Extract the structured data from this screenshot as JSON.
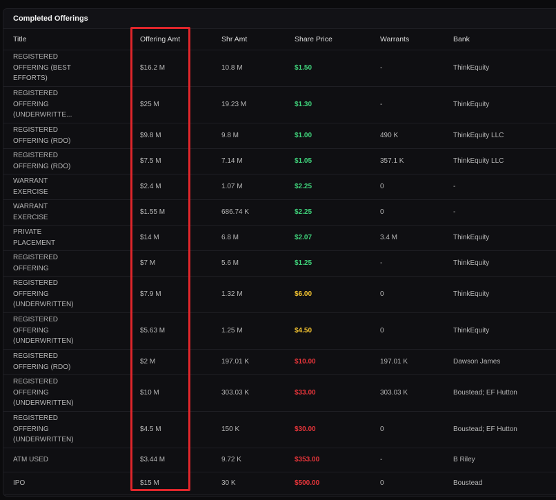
{
  "panel": {
    "title": "Completed Offerings"
  },
  "columns": [
    "Title",
    "Offering Amt",
    "Shr Amt",
    "Share Price",
    "Warrants",
    "Bank"
  ],
  "colors": {
    "green": "#3fd17a",
    "yellow": "#f2c230",
    "red": "#e8353a",
    "highlight": "#e0262b"
  },
  "rows": [
    {
      "title": "REGISTERED OFFERING (BEST EFFORTS)",
      "offering_amt": "$16.2 M",
      "shr_amt": "10.8 M",
      "share_price": "$1.50",
      "price_color": "green",
      "warrants": "-",
      "bank": "ThinkEquity",
      "h": 53
    },
    {
      "title": "REGISTERED OFFERING (UNDERWRITTE...",
      "offering_amt": "$25 M",
      "shr_amt": "19.23 M",
      "share_price": "$1.30",
      "price_color": "green",
      "warrants": "-",
      "bank": "ThinkEquity",
      "h": 53
    },
    {
      "title": "REGISTERED OFFERING (RDO)",
      "offering_amt": "$9.8 M",
      "shr_amt": "9.8 M",
      "share_price": "$1.00",
      "price_color": "green",
      "warrants": "490 K",
      "bank": "ThinkEquity LLC",
      "h": 37
    },
    {
      "title": "REGISTERED OFFERING (RDO)",
      "offering_amt": "$7.5 M",
      "shr_amt": "7.14 M",
      "share_price": "$1.05",
      "price_color": "green",
      "warrants": "357.1 K",
      "bank": "ThinkEquity LLC",
      "h": 37
    },
    {
      "title": "WARRANT EXERCISE",
      "offering_amt": "$2.4 M",
      "shr_amt": "1.07 M",
      "share_price": "$2.25",
      "price_color": "green",
      "warrants": "0",
      "bank": "-",
      "h": 37
    },
    {
      "title": "WARRANT EXERCISE",
      "offering_amt": "$1.55 M",
      "shr_amt": "686.74 K",
      "share_price": "$2.25",
      "price_color": "green",
      "warrants": "0",
      "bank": "-",
      "h": 37
    },
    {
      "title": "PRIVATE PLACEMENT",
      "offering_amt": "$14 M",
      "shr_amt": "6.8 M",
      "share_price": "$2.07",
      "price_color": "green",
      "warrants": "3.4 M",
      "bank": "ThinkEquity",
      "h": 37
    },
    {
      "title": "REGISTERED OFFERING",
      "offering_amt": "$7 M",
      "shr_amt": "5.6 M",
      "share_price": "$1.25",
      "price_color": "green",
      "warrants": "-",
      "bank": "ThinkEquity",
      "h": 37
    },
    {
      "title": "REGISTERED OFFERING (UNDERWRITTEN)",
      "offering_amt": "$7.9 M",
      "shr_amt": "1.32 M",
      "share_price": "$6.00",
      "price_color": "yellow",
      "warrants": "0",
      "bank": "ThinkEquity",
      "h": 53
    },
    {
      "title": "REGISTERED OFFERING (UNDERWRITTEN)",
      "offering_amt": "$5.63 M",
      "shr_amt": "1.25 M",
      "share_price": "$4.50",
      "price_color": "yellow",
      "warrants": "0",
      "bank": "ThinkEquity",
      "h": 53
    },
    {
      "title": "REGISTERED OFFERING (RDO)",
      "offering_amt": "$2 M",
      "shr_amt": "197.01 K",
      "share_price": "$10.00",
      "price_color": "red",
      "warrants": "197.01 K",
      "bank": "Dawson James",
      "h": 37
    },
    {
      "title": "REGISTERED OFFERING (UNDERWRITTEN)",
      "offering_amt": "$10 M",
      "shr_amt": "303.03 K",
      "share_price": "$33.00",
      "price_color": "red",
      "warrants": "303.03 K",
      "bank": "Boustead; EF Hutton",
      "h": 53
    },
    {
      "title": "REGISTERED OFFERING (UNDERWRITTEN)",
      "offering_amt": "$4.5 M",
      "shr_amt": "150 K",
      "share_price": "$30.00",
      "price_color": "red",
      "warrants": "0",
      "bank": "Boustead; EF Hutton",
      "h": 53
    },
    {
      "title": "ATM USED",
      "offering_amt": "$3.44 M",
      "shr_amt": "9.72 K",
      "share_price": "$353.00",
      "price_color": "red",
      "warrants": "-",
      "bank": "B Riley",
      "h": 35
    },
    {
      "title": "IPO",
      "offering_amt": "$15 M",
      "shr_amt": "30 K",
      "share_price": "$500.00",
      "price_color": "red",
      "warrants": "0",
      "bank": "Boustead",
      "h": 33
    }
  ]
}
